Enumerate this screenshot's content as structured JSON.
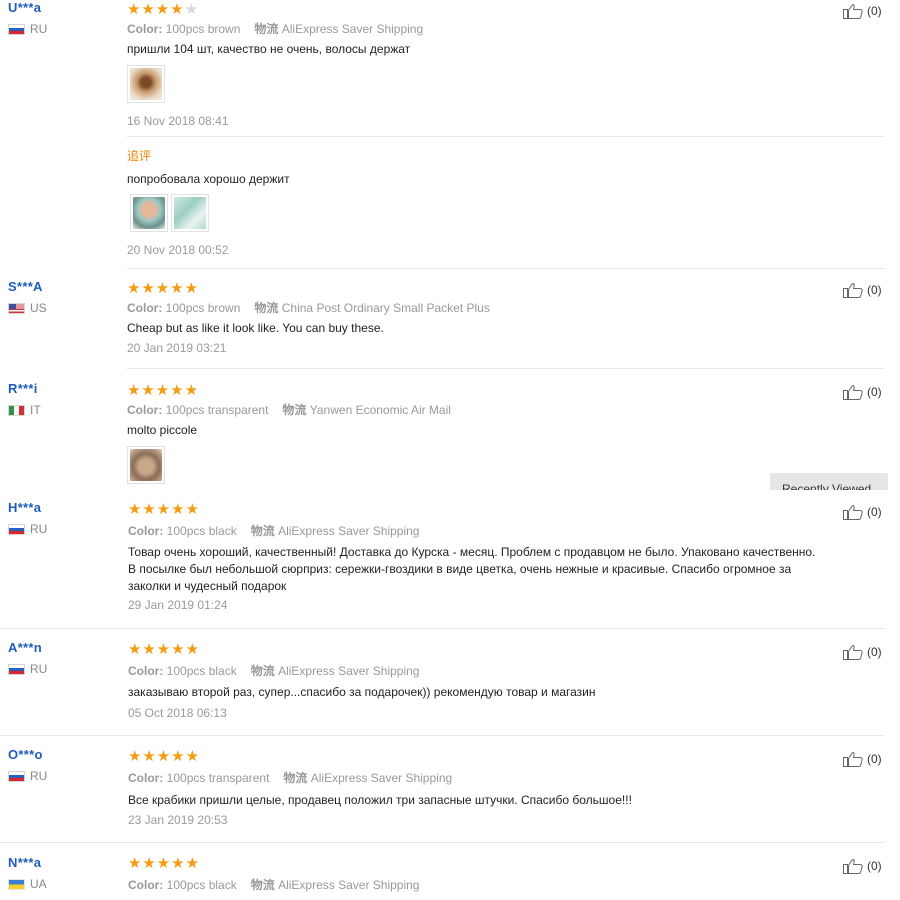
{
  "labels": {
    "color": "Color:",
    "shipping": "物流"
  },
  "followup_label": "追评",
  "recently_viewed": "Recently Viewed",
  "reviews": [
    {
      "user": "U***a",
      "country": "RU",
      "flag": "ru",
      "rating": 4,
      "color": "100pcs brown",
      "shipping": "AliExpress Saver Shipping",
      "text": "пришли 104 шт, качество не очень, волосы держат",
      "images": [
        "brown-hair-clip-photo"
      ],
      "date": "16 Nov 2018 08:41",
      "likes": "(0)",
      "followup": {
        "text": "попробовала хорошо держит",
        "images": [
          "face-photo",
          "transparent-clip-photo"
        ],
        "date": "20 Nov 2018 00:52"
      }
    },
    {
      "user": "S***A",
      "country": "US",
      "flag": "us",
      "rating": 5,
      "color": "100pcs brown",
      "shipping": "China Post Ordinary Small Packet Plus",
      "text": "Cheap but as like it look like. You can buy these.",
      "date": "20 Jan 2019 03:21",
      "likes": "(0)"
    },
    {
      "user": "R***i",
      "country": "IT",
      "flag": "it",
      "rating": 5,
      "color": "100pcs transparent",
      "shipping": "Yanwen Economic Air Mail",
      "text": "molto piccole",
      "images": [
        "bowl-of-clips-photo"
      ],
      "likes": "(0)"
    },
    {
      "user": "H***a",
      "country": "RU",
      "flag": "ru",
      "rating": 5,
      "color": "100pcs black",
      "shipping": "AliExpress Saver Shipping",
      "text_lines": [
        "Товар очень хороший, качественный! Доставка до Курска - месяц. Проблем с продавцом не было. Упаковано качественно.",
        "В посылке был небольшой сюрприз: сережки-гвоздики в виде цветка, очень нежные и красивые. Спасибо огромное за",
        "заколки и чудесный подарок"
      ],
      "date": "29 Jan 2019 01:24",
      "likes": "(0)"
    },
    {
      "user": "A***n",
      "country": "RU",
      "flag": "ru",
      "rating": 5,
      "color": "100pcs black",
      "shipping": "AliExpress Saver Shipping",
      "text": "заказываю второй раз, супер...спасибо за подарочек)) рекомендую товар и магазин",
      "date": "05 Oct 2018 06:13",
      "likes": "(0)"
    },
    {
      "user": "O***o",
      "country": "RU",
      "flag": "ru",
      "rating": 5,
      "color": "100pcs transparent",
      "shipping": "AliExpress Saver Shipping",
      "text": "Все крабики пришли целые, продавец положил три запасные штучки. Спасибо большое!!!",
      "date": "23 Jan 2019 20:53",
      "likes": "(0)"
    },
    {
      "user": "N***a",
      "country": "UA",
      "flag": "ua",
      "rating": 5,
      "color": "100pcs black",
      "shipping": "AliExpress Saver Shipping",
      "likes": "(0)"
    }
  ],
  "colors": {
    "accent_star": "#f39c12",
    "username": "#1f5db9",
    "followup": "#f08200"
  },
  "icons": {
    "star": "star-icon",
    "like": "thumbs-up-icon"
  }
}
